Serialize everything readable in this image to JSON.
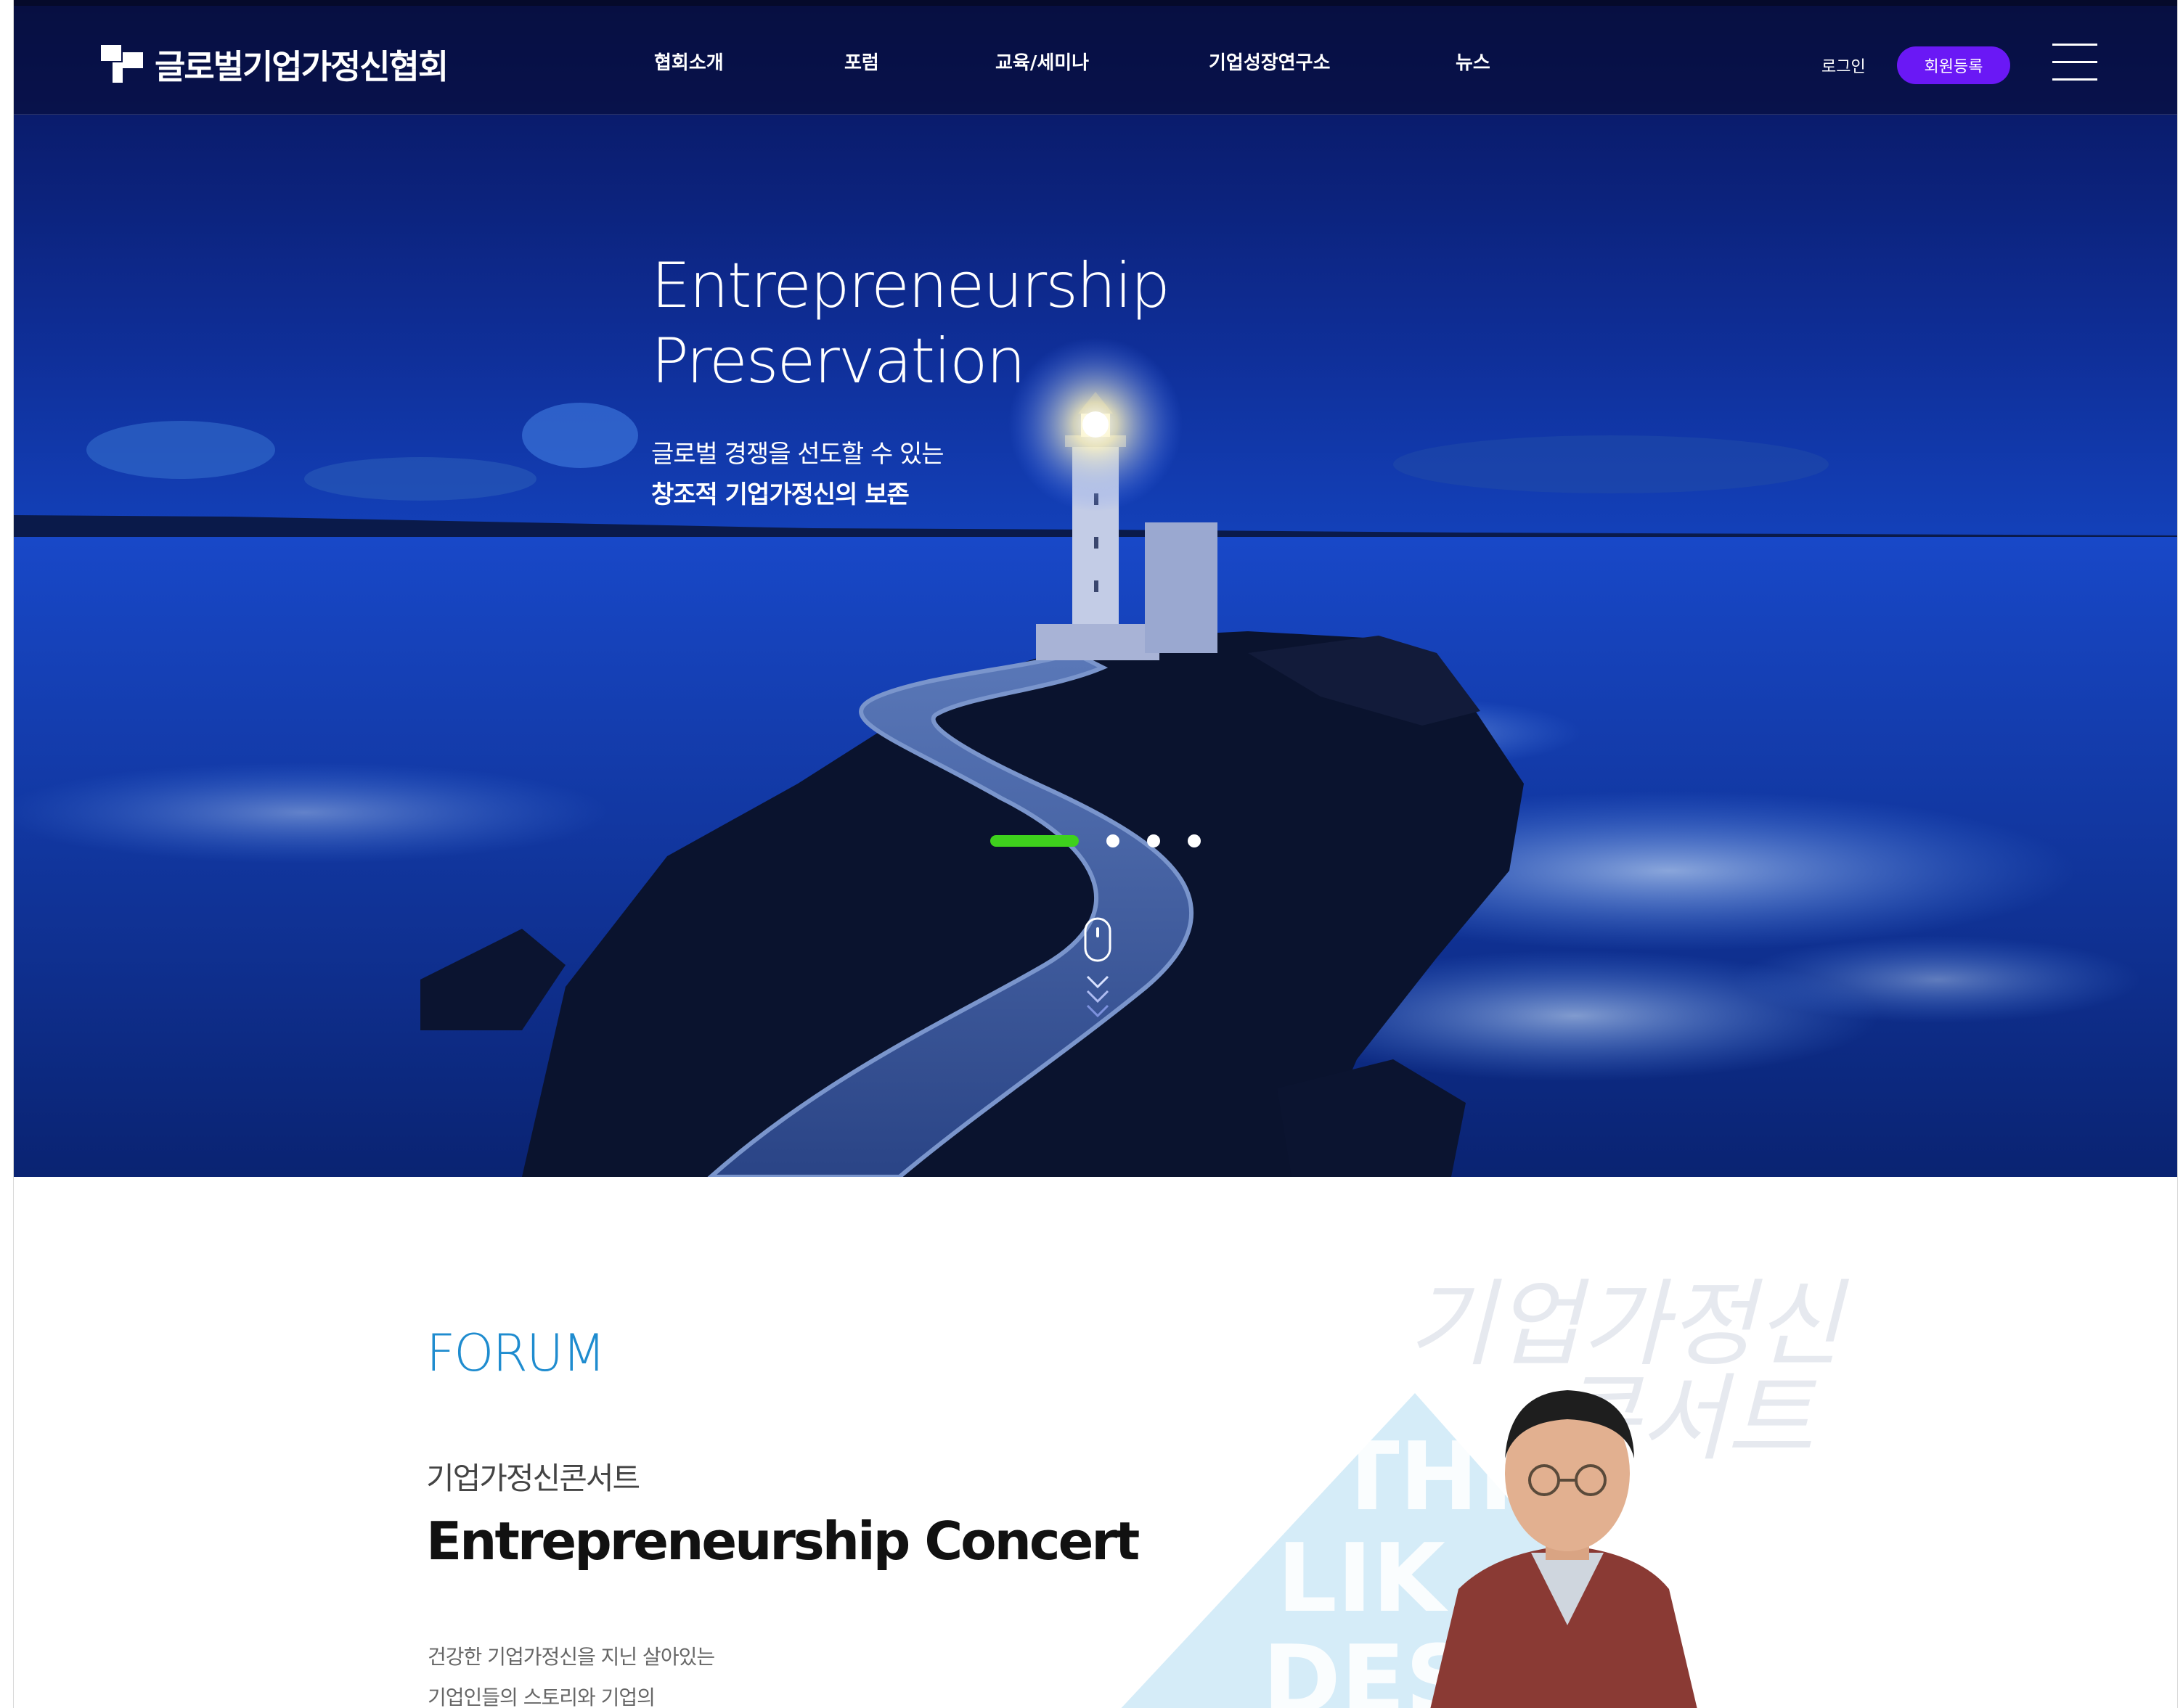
{
  "header": {
    "logo_text": "글로벌기업가정신협회",
    "nav": [
      {
        "label": "협회소개"
      },
      {
        "label": "포럼"
      },
      {
        "label": "교육/세미나"
      },
      {
        "label": "기업성장연구소"
      },
      {
        "label": "뉴스"
      }
    ],
    "login_label": "로그인",
    "register_label": "회원등록",
    "menu_icon": "hamburger-menu-icon"
  },
  "hero": {
    "title_line1": "Entrepreneurship",
    "title_line2": "Preservation",
    "subtitle_line1": "글로벌 경쟁을 선도할 수 있는",
    "subtitle_line2": "창조적 기업가정신의 보존",
    "slides_total": 4,
    "active_slide": 1,
    "background": "lighthouse-night-seascape",
    "scroll_icon": "mouse-scroll-icon",
    "colors": {
      "pager_active": "#3ed11d",
      "overlay": "#0b1e72"
    }
  },
  "forum": {
    "section_label": "FORUM",
    "title_korean": "기업가정신콘서트",
    "title_english": "Entrepreneurship Concert",
    "desc_line1": "건강한 기업가정신을 지닌 살아있는",
    "desc_line2": "기업인들의 스토리와 기업의",
    "visual_calligraphy_line1": "기업가정신",
    "visual_calligraphy_line2": "콘서트",
    "visual_poster_text": [
      "THI",
      "LIK",
      "DES"
    ],
    "colors": {
      "section_label": "#1f8ccf"
    }
  },
  "colors": {
    "accent": "#6a18f5",
    "header_bg": "#0a1448"
  }
}
